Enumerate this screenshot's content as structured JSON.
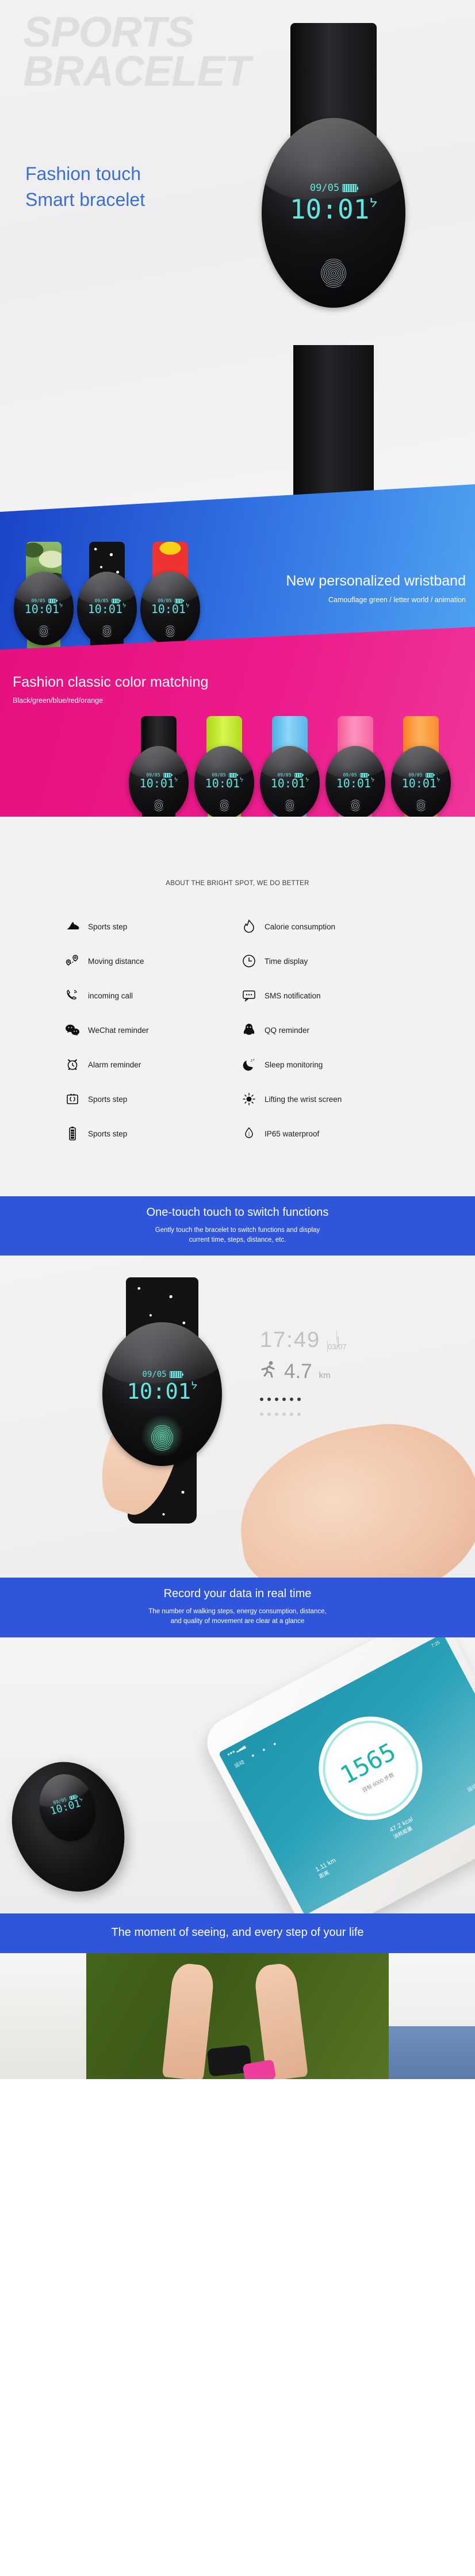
{
  "hero": {
    "watermark": "SPORTS\nBRACELET",
    "title": "Fashion touch\nSmart bracelet",
    "watch": {
      "date": "09/05",
      "time": "10:01",
      "bluetooth_icon": "bluetooth-icon",
      "battery_icon": "battery-icon",
      "fingerprint_icon": "fingerprint-icon"
    }
  },
  "banner_personalized": {
    "title": "New personalized wristband",
    "subtitle": "Camouflage green / letter world / animation",
    "watches": [
      {
        "pattern": "camouflage-green",
        "date": "09/05",
        "time": "10:01"
      },
      {
        "pattern": "letter-world",
        "date": "09/05",
        "time": "10:01"
      },
      {
        "pattern": "animation-comic",
        "date": "09/05",
        "time": "10:01"
      }
    ]
  },
  "banner_colors": {
    "title": "Fashion classic color matching",
    "subtitle": "Black/green/blue/red/orange",
    "watches": [
      {
        "color_name": "black",
        "hex": "#111111",
        "date": "09/05",
        "time": "10:01"
      },
      {
        "color_name": "green",
        "hex": "#c6e82c",
        "date": "09/05",
        "time": "10:01"
      },
      {
        "color_name": "blue",
        "hex": "#6cc3ef",
        "date": "09/05",
        "time": "10:01"
      },
      {
        "color_name": "red",
        "hex": "#f56aa6",
        "date": "09/05",
        "time": "10:01"
      },
      {
        "color_name": "orange",
        "hex": "#f79327",
        "date": "09/05",
        "time": "10:01"
      }
    ]
  },
  "features": {
    "heading": "ABOUT THE BRIGHT SPOT, WE DO BETTER",
    "items": [
      {
        "icon": "running-shoe-icon",
        "label": "Sports step"
      },
      {
        "icon": "flame-icon",
        "label": "Calorie consumption"
      },
      {
        "icon": "map-pin-route-icon",
        "label": "Moving distance"
      },
      {
        "icon": "clock-icon",
        "label": "Time display"
      },
      {
        "icon": "phone-ringing-icon",
        "label": "incoming call"
      },
      {
        "icon": "message-bubble-icon",
        "label": "SMS notification"
      },
      {
        "icon": "wechat-icon",
        "label": "WeChat reminder"
      },
      {
        "icon": "qq-penguin-icon",
        "label": "QQ reminder"
      },
      {
        "icon": "alarm-clock-icon",
        "label": "Alarm reminder"
      },
      {
        "icon": "moon-sleep-icon",
        "label": "Sleep monitoring"
      },
      {
        "icon": "pedometer-icon",
        "label": "Sports step"
      },
      {
        "icon": "sun-brightness-icon",
        "label": "Lifting the wrist screen"
      },
      {
        "icon": "battery-icon",
        "label": "Sports step"
      },
      {
        "icon": "water-drop-icon",
        "label": "IP65 waterproof"
      }
    ]
  },
  "cta_touch": {
    "title": "One-touch touch to switch functions",
    "subtitle": "Gently touch the bracelet to switch functions and display\ncurrent time, steps, distance, etc."
  },
  "touch_demo": {
    "watch": {
      "date": "09/05",
      "time": "10:01",
      "pattern": "letter-world"
    },
    "stats": {
      "time": "17:49",
      "date": "03/07",
      "distance_value": "4.7",
      "distance_unit": "km",
      "runner_icon": "running-person-icon",
      "battery_icon": "battery-icon",
      "dots_active": 6,
      "dots_inactive": 6
    }
  },
  "cta_record": {
    "title": "Record your data in real time",
    "subtitle": "The number of walking steps, energy consumption, distance,\nand quality of movement are clear at a glance"
  },
  "app_section": {
    "status_left": "●●●  ▂▃▄",
    "status_right": "7:25",
    "tabs": [
      "运动",
      "●",
      "●",
      "●"
    ],
    "steps_value": "1565",
    "steps_goal": "目标 6000 步数",
    "metrics": [
      {
        "value": "1.11 km",
        "label": "距离"
      },
      {
        "value": "47.2 kcal",
        "label": "消耗能量"
      },
      {
        "value": "",
        "label": "运动大少"
      }
    ],
    "bracelet": {
      "date": "09/05",
      "time": "10:01"
    }
  },
  "cta_moment": {
    "title": "The moment of seeing, and every step of your life"
  },
  "colors": {
    "accent_blue": "#2f55db",
    "banner_blue": "#2f6ee0",
    "banner_pink": "#ec1b8c",
    "screen_cyan": "#63e5e0",
    "app_teal": "#2ba2b8"
  }
}
